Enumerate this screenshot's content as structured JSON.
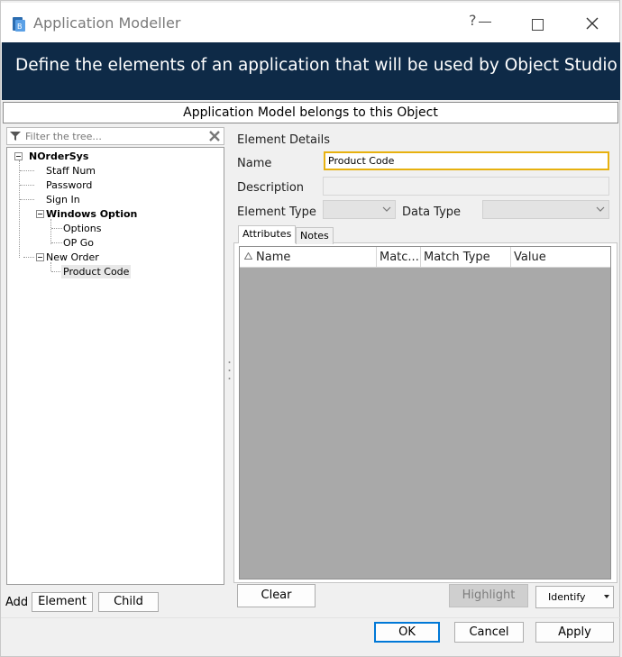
{
  "window": {
    "title": "Application Modeller",
    "help_glyph": "?"
  },
  "banner": {
    "text": "Define the elements of an application that will be used by Object Studio"
  },
  "belongs_bar": "Application Model belongs to this Object",
  "tree": {
    "filter_placeholder": "Filter the tree...",
    "nodes": [
      {
        "label": "NOrderSys",
        "bold": true
      },
      {
        "label": "Staff Num"
      },
      {
        "label": "Password"
      },
      {
        "label": "Sign In"
      },
      {
        "label": "Windows Option",
        "bold": true
      },
      {
        "label": "Options"
      },
      {
        "label": "OP Go"
      },
      {
        "label": "New Order"
      },
      {
        "label": "Product Code",
        "selected": true
      }
    ]
  },
  "add_bar": {
    "label": "Add",
    "element_button": "Element",
    "child_button": "Child"
  },
  "details": {
    "header": "Element Details",
    "name_label": "Name",
    "name_value": "Product Code",
    "description_label": "Description",
    "description_value": "",
    "element_type_label": "Element Type",
    "data_type_label": "Data Type"
  },
  "tabs": [
    "Attributes",
    "Notes"
  ],
  "grid_columns": [
    "Name",
    "Matc...",
    "Match Type",
    "Value"
  ],
  "actions": {
    "clear": "Clear",
    "highlight": "Highlight",
    "identify": "Identify"
  },
  "footer": {
    "ok": "OK",
    "cancel": "Cancel",
    "apply": "Apply"
  },
  "colors": {
    "banner_bg": "#0e2a47",
    "focus_border": "#e7b10f",
    "default_button_border": "#0078d7",
    "grid_bg": "#a9a9a9"
  }
}
